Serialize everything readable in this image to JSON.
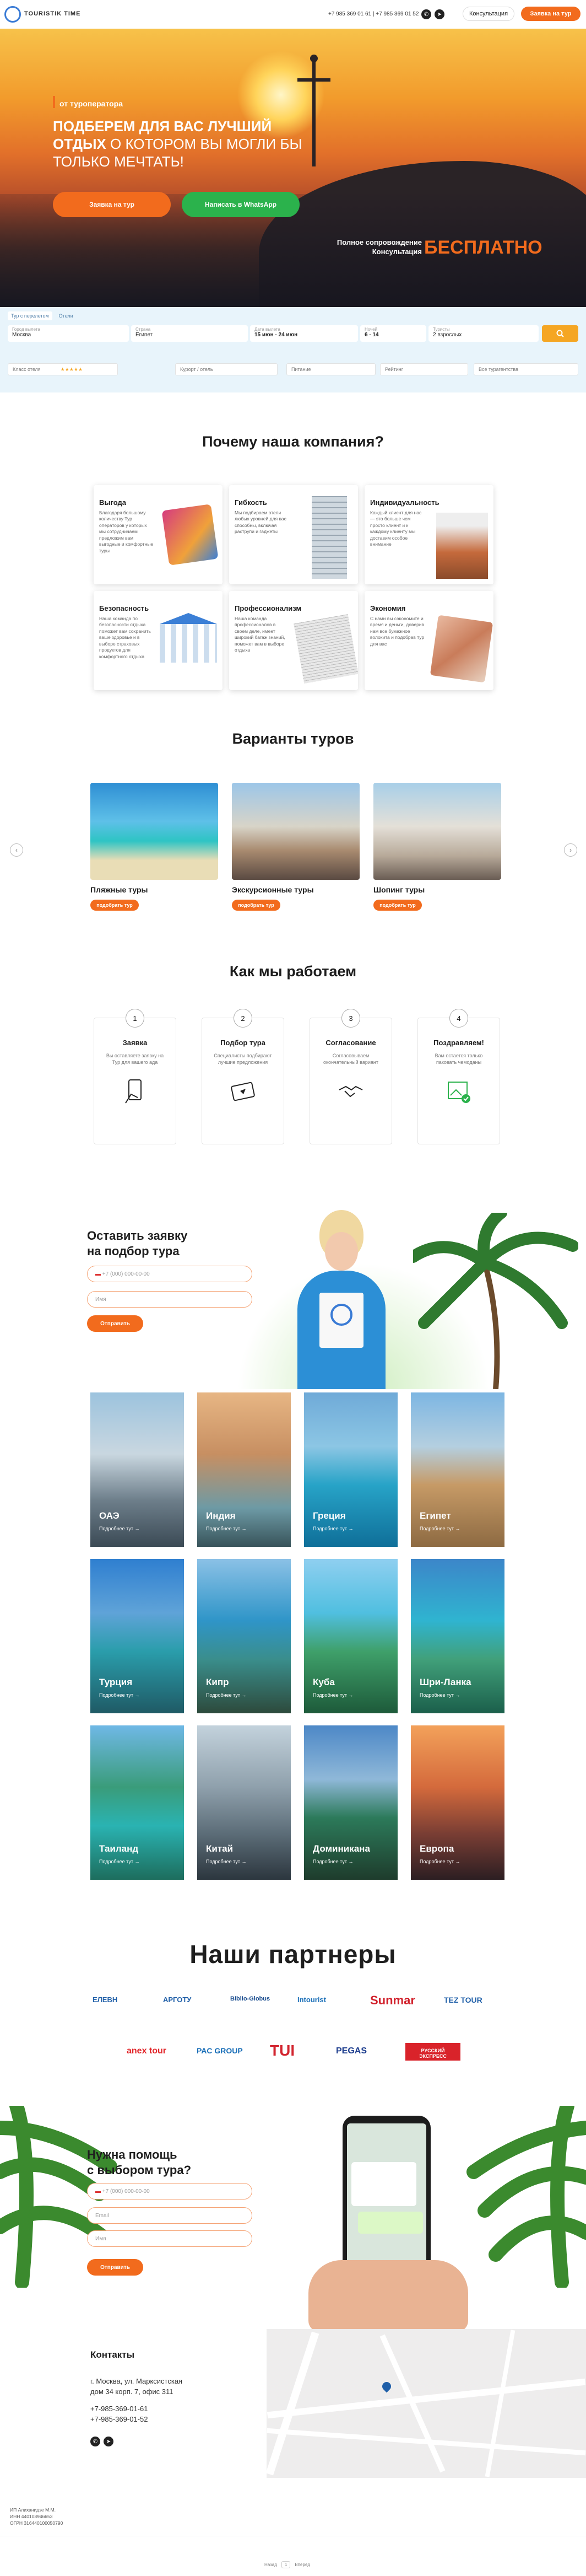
{
  "header": {
    "brand": "TOURISTIK TIME",
    "phones": "+7 985 369 01 61  |  +7 985 369 01 52",
    "consult_btn": "Консультация",
    "request_btn": "Заявка на тур"
  },
  "hero": {
    "tag": "от туроператора",
    "title_1": "ПОДБЕРЕМ ДЛЯ ВАС ЛУЧШИЙ",
    "title_2a": "ОТДЫХ",
    "title_2b": " О КОТОРОМ ВЫ МОГЛИ БЫ",
    "title_3": "ТОЛЬКО МЕЧТАТЬ!",
    "btn_request": "Заявка на тур",
    "btn_whatsapp": "Написать в WhatsApp",
    "support_line1": "Полное сопровождение",
    "support_line2": "Консультация",
    "support_free": "БЕСПЛАТНО"
  },
  "search": {
    "tabs": [
      "Тур с перелетом",
      "Отели"
    ],
    "fields": [
      {
        "label": "Город вылета",
        "value": "Москва"
      },
      {
        "label": "Страна",
        "value": "Египет"
      },
      {
        "label": "Дата вылета",
        "value": "15 июн - 24 июн"
      },
      {
        "label": "Ночей",
        "value": "6 - 14"
      },
      {
        "label": "Туристы",
        "value": "2 взрослых"
      }
    ],
    "filters": [
      "Класс отеля",
      "Курорт / отель",
      "Питание",
      "Рейтинг",
      "Все турагентства"
    ],
    "search_icon": "search-icon"
  },
  "why": {
    "title": "Почему наша компания?",
    "cards": [
      {
        "title": "Выгода",
        "text": "Благодаря большому количеству Тур операторов у которых мы сотрудничаем предложим вам выгодные и комфортные туры"
      },
      {
        "title": "Гибкость",
        "text": "Мы подбираем отели любых уровней для вас способны, включая раструпи и гаджеты"
      },
      {
        "title": "Индивидуальность",
        "text": "Каждый клиент для нас — это больше чем просто клиент и к каждому клиенту мы доставим особое внимание"
      },
      {
        "title": "Безопасность",
        "text": "Наша команда по безопасности отдыха поможет вам сохранить ваше здоровье и в выборе страховых продуктов для комфортного отдыха"
      },
      {
        "title": "Профессионализм",
        "text": "Наша команда профессионалов в своем деле, имеет широкий багаж знаний, поможет вам в выборе отдыха"
      },
      {
        "title": "Экономия",
        "text": "С нами вы сэкономите и время и деньги, доверив нам все бумажное волокита и подобрав тур для вас"
      }
    ]
  },
  "tours": {
    "title": "Варианты туров",
    "items": [
      {
        "title": "Пляжные туры",
        "btn": "подобрать тур"
      },
      {
        "title": "Экскурсионные туры",
        "btn": "подобрать тур"
      },
      {
        "title": "Шопинг туры",
        "btn": "подобрать тур"
      }
    ]
  },
  "how": {
    "title": "Как мы работаем",
    "steps": [
      {
        "num": "1",
        "title": "Заявка",
        "text": "Вы оставляете заявку на Тур для вашего ада"
      },
      {
        "num": "2",
        "title": "Подбор тура",
        "text": "Специалисты подбирают лучшие предложения"
      },
      {
        "num": "3",
        "title": "Согласование",
        "text": "Согласовываем окончательный вариант"
      },
      {
        "num": "4",
        "title": "Поздравляем!",
        "text": "Вам остается только паковать чемоданы"
      }
    ]
  },
  "form1": {
    "title_1": "Оставить заявку",
    "title_2": "на подбор тура",
    "phone_placeholder": "+7 (000) 000-00-00",
    "name_placeholder": "Имя",
    "submit": "Отправить"
  },
  "destinations": [
    {
      "name": "ОАЭ",
      "more": "Подробнее тут →"
    },
    {
      "name": "Индия",
      "more": "Подробнее тут →"
    },
    {
      "name": "Греция",
      "more": "Подробнее тут →"
    },
    {
      "name": "Египет",
      "more": "Подробнее тут →"
    },
    {
      "name": "Турция",
      "more": "Подробнее тут →"
    },
    {
      "name": "Кипр",
      "more": "Подробнее тут →"
    },
    {
      "name": "Куба",
      "more": "Подробнее тут →"
    },
    {
      "name": "Шри-Ланка",
      "more": "Подробнее тут →"
    },
    {
      "name": "Таиланд",
      "more": "Подробнее тут →"
    },
    {
      "name": "Китай",
      "more": "Подробнее тут →"
    },
    {
      "name": "Доминикана",
      "more": "Подробнее тут →"
    },
    {
      "name": "Европа",
      "more": "Подробнее тут →"
    }
  ],
  "partners": {
    "title": "Наши партнеры",
    "row1": [
      "ЕЛЕВН",
      "АРГОТУ",
      "Biblio-Globus",
      "Intourist",
      "Sunmar",
      "TEZ TOUR"
    ],
    "row2": [
      "anex tour",
      "PAC GROUP",
      "TUI",
      "PEGAS",
      "РУССКИЙ ЭКСПРЕСС"
    ]
  },
  "form2": {
    "title_1": "Нужна помощь",
    "title_2": "с выбором тура?",
    "phone_placeholder": "+7 (000) 000-00-00",
    "email_placeholder": "Email",
    "name_placeholder": "Имя",
    "submit": "Отправить"
  },
  "contacts": {
    "title": "Контакты",
    "address_1": "г. Москва, ул. Марксистская",
    "address_2": "дом 34 корп. 7, офис 311",
    "phone_1": "+7-985-369-01-61",
    "phone_2": "+7-985-369-01-52"
  },
  "footer": {
    "company_1": "ИП Алиханидзе М.М.",
    "company_2": "ИНН 440108946653",
    "company_3": "ОГРН 316440100050790",
    "pager_label": "Назад",
    "pager_page": "1",
    "pager_next": "Вперед"
  },
  "colors": {
    "accent": "#f26b1d",
    "whatsapp": "#2bb24c",
    "search_bg": "#e8f4fb"
  }
}
